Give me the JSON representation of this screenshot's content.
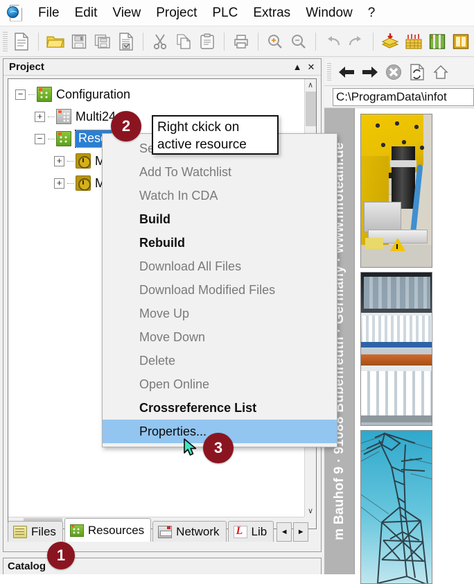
{
  "app": {
    "icon": "app-globe-page-icon"
  },
  "menubar": {
    "items": [
      {
        "label": "File",
        "name": "menu-file"
      },
      {
        "label": "Edit",
        "name": "menu-edit"
      },
      {
        "label": "View",
        "name": "menu-view"
      },
      {
        "label": "Project",
        "name": "menu-project"
      },
      {
        "label": "PLC",
        "name": "menu-plc"
      },
      {
        "label": "Extras",
        "name": "menu-extras"
      },
      {
        "label": "Window",
        "name": "menu-window"
      },
      {
        "label": "?",
        "name": "menu-help"
      }
    ]
  },
  "toolbar": {
    "buttons": [
      {
        "icon": "new-file-icon"
      },
      {
        "icon": "open-folder-icon"
      },
      {
        "icon": "save-icon"
      },
      {
        "icon": "save-all-icon"
      },
      {
        "icon": "save-as-icon"
      },
      {
        "icon": "cut-icon"
      },
      {
        "icon": "copy-icon"
      },
      {
        "icon": "paste-icon"
      },
      {
        "icon": "print-icon"
      },
      {
        "icon": "zoom-in-icon"
      },
      {
        "icon": "zoom-out-icon"
      },
      {
        "icon": "undo-icon"
      },
      {
        "icon": "redo-icon"
      },
      {
        "icon": "build-download-icon"
      },
      {
        "icon": "watchlist-icon"
      },
      {
        "icon": "variables-icon"
      },
      {
        "icon": "resource-icon"
      }
    ]
  },
  "project_panel": {
    "title": "Project",
    "collapse_label": "▲",
    "close_label": "✕",
    "tree": [
      {
        "label": "Configuration",
        "icon": "configuration-icon",
        "expander": "−",
        "level": 0,
        "selected": false
      },
      {
        "label": "Multi24",
        "icon": "device-icon",
        "expander": "+",
        "level": 1,
        "selected": false
      },
      {
        "label": "Reso",
        "icon": "resource-icon",
        "expander": "−",
        "level": 1,
        "selected": true
      },
      {
        "label": "M",
        "icon": "task-clock-icon",
        "expander": "+",
        "level": 2,
        "selected": false
      },
      {
        "label": "M",
        "icon": "task-clock-icon",
        "expander": "+",
        "level": 2,
        "selected": false
      }
    ],
    "scroll": {
      "up_arrow": "∧",
      "down_arrow": "∨",
      "left_arrow": "‹",
      "right_arrow": "›"
    },
    "tabs": [
      {
        "label": "Files",
        "icon": "files-icon",
        "active": false
      },
      {
        "label": "Resources",
        "icon": "resources-icon",
        "active": true
      },
      {
        "label": "Network",
        "icon": "network-icon",
        "active": false
      },
      {
        "label": "Lib",
        "icon": "library-icon",
        "active": false
      }
    ],
    "tab_nav": {
      "prev": "◄",
      "next": "►"
    }
  },
  "catalog_panel": {
    "title": "Catalog"
  },
  "context_menu": {
    "items": [
      {
        "label": "Set",
        "enabled": false,
        "highlighted": false,
        "name": "ctx-set-active-resource"
      },
      {
        "label": "Add To Watchlist",
        "enabled": false,
        "highlighted": false,
        "name": "ctx-add-to-watchlist"
      },
      {
        "label": "Watch In CDA",
        "enabled": false,
        "highlighted": false,
        "name": "ctx-watch-in-cda"
      },
      {
        "label": "Build",
        "enabled": true,
        "highlighted": false,
        "name": "ctx-build"
      },
      {
        "label": "Rebuild",
        "enabled": true,
        "highlighted": false,
        "name": "ctx-rebuild"
      },
      {
        "label": "Download All Files",
        "enabled": false,
        "highlighted": false,
        "name": "ctx-download-all-files"
      },
      {
        "label": "Download Modified Files",
        "enabled": false,
        "highlighted": false,
        "name": "ctx-download-modified-files"
      },
      {
        "label": "Move Up",
        "enabled": false,
        "highlighted": false,
        "name": "ctx-move-up"
      },
      {
        "label": "Move Down",
        "enabled": false,
        "highlighted": false,
        "name": "ctx-move-down"
      },
      {
        "label": "Delete",
        "enabled": false,
        "highlighted": false,
        "name": "ctx-delete"
      },
      {
        "label": "Open Online",
        "enabled": false,
        "highlighted": false,
        "name": "ctx-open-online"
      },
      {
        "label": "Crossreference List",
        "enabled": true,
        "highlighted": false,
        "name": "ctx-crossreference-list"
      },
      {
        "label": "Properties...",
        "enabled": true,
        "highlighted": true,
        "name": "ctx-properties"
      }
    ]
  },
  "tooltip": {
    "line1": "Right ckick on",
    "line2": "active resource"
  },
  "badges": [
    {
      "number": "1",
      "name": "step-badge-1"
    },
    {
      "number": "2",
      "name": "step-badge-2"
    },
    {
      "number": "3",
      "name": "step-badge-3"
    }
  ],
  "browser": {
    "buttons": [
      {
        "icon": "back-arrow-icon"
      },
      {
        "icon": "forward-arrow-icon"
      },
      {
        "icon": "stop-icon"
      },
      {
        "icon": "refresh-icon"
      },
      {
        "icon": "home-icon"
      }
    ],
    "address": "C:\\ProgramData\\infot",
    "sidebar_text": "m Bauhof 9 · 91088 Bubenreuth · Germany · www.infoteam.de",
    "photos": [
      {
        "name": "photo-robot-arm"
      },
      {
        "name": "photo-production-line"
      },
      {
        "name": "photo-power-pylon"
      }
    ]
  },
  "colors": {
    "badge": "#8a1520",
    "menu_highlight": "#92c5f0",
    "tree_selection": "#2a7fd4",
    "toolbar_bg": "#f3f3f3"
  }
}
